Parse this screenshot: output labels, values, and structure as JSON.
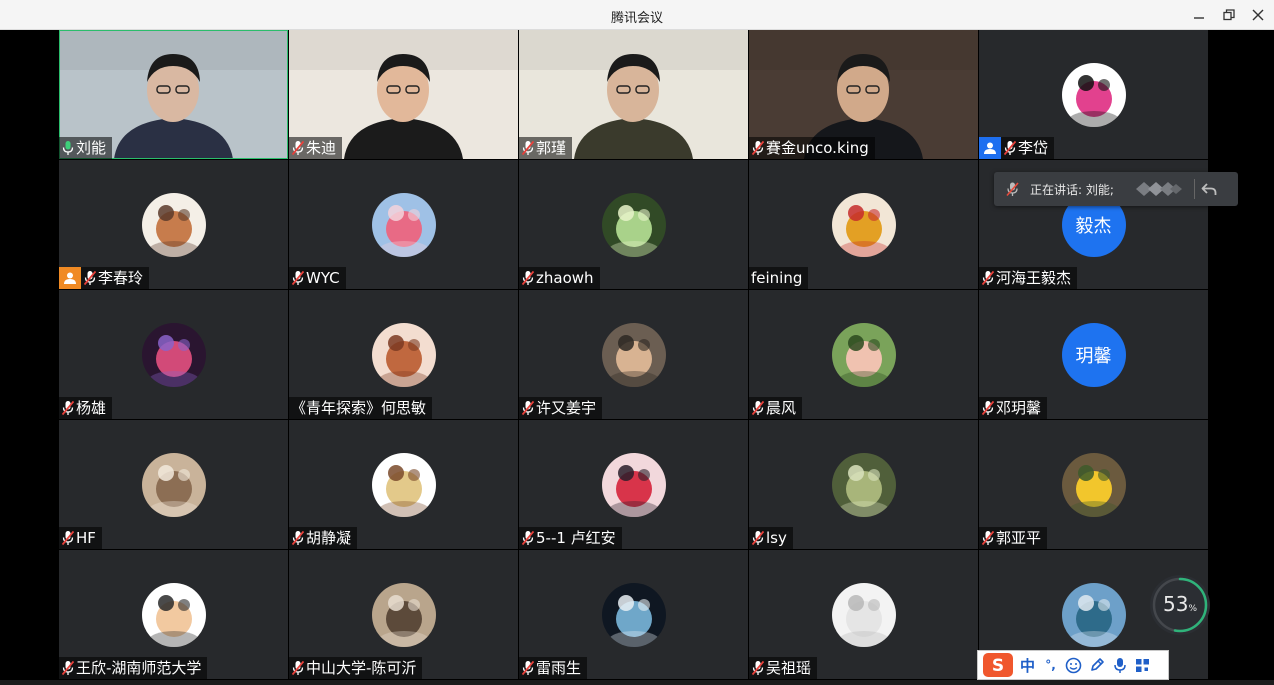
{
  "window": {
    "title": "腾讯会议"
  },
  "participants": [
    {
      "name": "刘能",
      "mic": "on",
      "badge": "",
      "kind": "video",
      "active": true,
      "palette": [
        "#b9c3c9",
        "#d9b8a2",
        "#2a3044"
      ]
    },
    {
      "name": "朱迪",
      "mic": "muted",
      "badge": "",
      "kind": "video",
      "palette": [
        "#ece7df",
        "#e2b89a",
        "#1b1b1b"
      ]
    },
    {
      "name": "郭瑾",
      "mic": "muted",
      "badge": "",
      "kind": "video",
      "palette": [
        "#e9e6dc",
        "#d8b59a",
        "#3a3a2c"
      ]
    },
    {
      "name": "賽金unco.king",
      "mic": "muted",
      "badge": "",
      "kind": "video",
      "palette": [
        "#4a3c34",
        "#d1a98a",
        "#15171b"
      ]
    },
    {
      "name": "李岱",
      "mic": "muted",
      "badge": "blue",
      "kind": "avatar",
      "avatar_icon": "minnie-mouse-avatar",
      "colors": [
        "#ffffff",
        "#e2418e",
        "#111111"
      ]
    },
    {
      "name": "李春玲",
      "mic": "muted",
      "badge": "orange",
      "kind": "avatar",
      "avatar_icon": "portrait-sketch-avatar",
      "colors": [
        "#f4efe7",
        "#c77c4c",
        "#5a3a2a"
      ]
    },
    {
      "name": "WYC",
      "mic": "muted",
      "badge": "",
      "kind": "avatar",
      "avatar_icon": "kirby-avatar",
      "colors": [
        "#9fc1e6",
        "#e86a85",
        "#f3d2da"
      ]
    },
    {
      "name": "zhaowh",
      "mic": "muted",
      "badge": "",
      "kind": "avatar",
      "avatar_icon": "forest-light-avatar",
      "colors": [
        "#314a26",
        "#a9d28a",
        "#e7f3c9"
      ]
    },
    {
      "name": "feining",
      "mic": "none",
      "badge": "",
      "kind": "avatar",
      "avatar_icon": "winnie-the-pooh-avatar",
      "colors": [
        "#f2e6d6",
        "#e3a024",
        "#c62b2b"
      ]
    },
    {
      "name": "河海王毅杰",
      "mic": "muted",
      "badge": "",
      "kind": "text",
      "avatar_text": "毅杰"
    },
    {
      "name": "杨雄",
      "mic": "muted",
      "badge": "",
      "kind": "avatar",
      "avatar_icon": "night-city-avatar",
      "colors": [
        "#2a1530",
        "#d24a78",
        "#8a63c9"
      ]
    },
    {
      "name": "《青年探索》何思敏",
      "mic": "none",
      "badge": "",
      "kind": "avatar",
      "avatar_icon": "illustrated-girl-avatar",
      "colors": [
        "#f3ddd0",
        "#c0683f",
        "#7b3a22"
      ]
    },
    {
      "name": "许又姜宇",
      "mic": "muted",
      "badge": "",
      "kind": "avatar",
      "avatar_icon": "group-photo-avatar",
      "colors": [
        "#6b5e52",
        "#d8b392",
        "#2d2823"
      ]
    },
    {
      "name": "晨风",
      "mic": "muted",
      "badge": "",
      "kind": "avatar",
      "avatar_icon": "baby-photo-avatar",
      "colors": [
        "#7aa35a",
        "#f0c2b0",
        "#2c4a1f"
      ]
    },
    {
      "name": "邓玥馨",
      "mic": "muted",
      "badge": "",
      "kind": "text",
      "avatar_text": "玥馨"
    },
    {
      "name": "HF",
      "mic": "muted",
      "badge": "",
      "kind": "avatar",
      "avatar_icon": "cafe-photo-avatar",
      "colors": [
        "#c9b39a",
        "#8c6e54",
        "#f2e9dc"
      ]
    },
    {
      "name": "胡静凝",
      "mic": "muted",
      "badge": "",
      "kind": "avatar",
      "avatar_icon": "cartoon-girl-avatar",
      "colors": [
        "#ffffff",
        "#e3c98a",
        "#7a4a2a"
      ]
    },
    {
      "name": "5--1 卢红安",
      "mic": "muted",
      "badge": "",
      "kind": "avatar",
      "avatar_icon": "anime-avatar",
      "colors": [
        "#f2d8dc",
        "#d8344a",
        "#2a1f2a"
      ]
    },
    {
      "name": "lsy",
      "mic": "muted",
      "badge": "",
      "kind": "avatar",
      "avatar_icon": "leaf-avatar",
      "colors": [
        "#505f3a",
        "#a8b57a",
        "#d9e2bd"
      ]
    },
    {
      "name": "郭亚平",
      "mic": "muted",
      "badge": "",
      "kind": "avatar",
      "avatar_icon": "yellow-rose-avatar",
      "colors": [
        "#6b5a3e",
        "#f2c62c",
        "#3d5a2a"
      ]
    },
    {
      "name": "王欣-湖南师范大学",
      "mic": "muted",
      "badge": "",
      "kind": "avatar",
      "avatar_icon": "cartoon-boy-heart-avatar",
      "colors": [
        "#ffffff",
        "#f2c9a0",
        "#2a2a2a"
      ]
    },
    {
      "name": "中山大学-陈可沂",
      "mic": "muted",
      "badge": "",
      "kind": "avatar",
      "avatar_icon": "street-photo-avatar",
      "colors": [
        "#b9a58c",
        "#5c4a3a",
        "#e7ddd0"
      ]
    },
    {
      "name": "雷雨生",
      "mic": "muted",
      "badge": "",
      "kind": "avatar",
      "avatar_icon": "dark-poster-avatar",
      "colors": [
        "#0f1722",
        "#6fa7c9",
        "#e8eef3"
      ]
    },
    {
      "name": "吴祖瑶",
      "mic": "muted",
      "badge": "",
      "kind": "avatar",
      "avatar_icon": "white-blank-avatar",
      "colors": [
        "#f3f3f3",
        "#e5e5e5",
        "#b7b7b7"
      ]
    },
    {
      "name": "",
      "mic": "none",
      "badge": "",
      "kind": "avatar",
      "avatar_icon": "lake-mountain-avatar",
      "colors": [
        "#6da0c9",
        "#2e6b8a",
        "#dfe9f0"
      ]
    }
  ],
  "speaking": {
    "label": "正在讲话: 刘能;"
  },
  "network_gauge": {
    "value": "53",
    "unit": "%",
    "fraction": 0.53
  },
  "ime_toolbar": {
    "mode_label": "中",
    "punct_label": "°,"
  }
}
